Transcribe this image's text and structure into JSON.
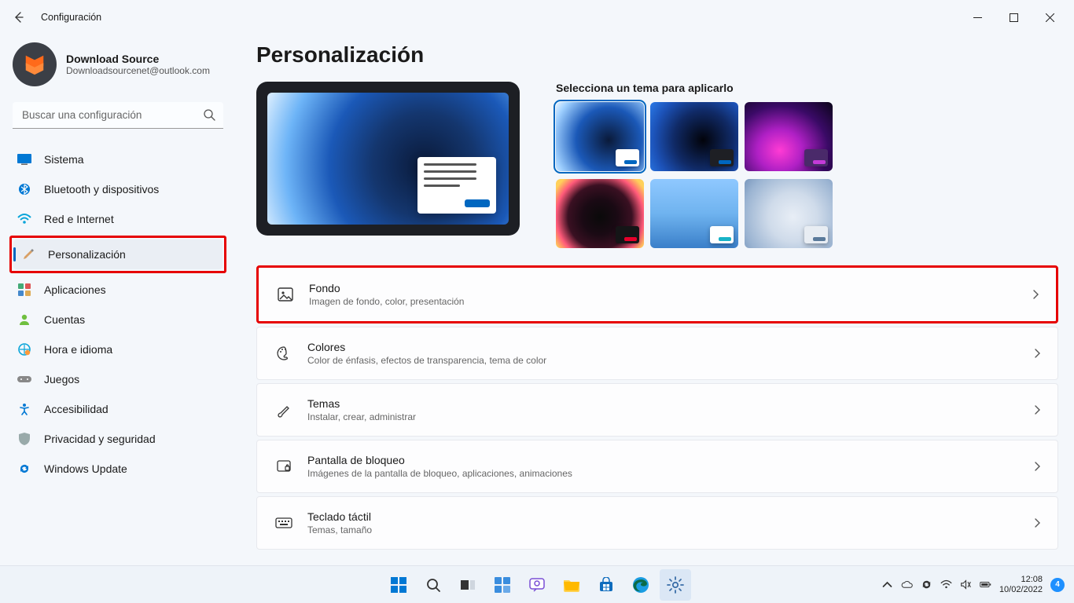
{
  "titlebar": {
    "title": "Configuración"
  },
  "profile": {
    "name": "Download Source",
    "email": "Downloadsourcenet@outlook.com"
  },
  "search": {
    "placeholder": "Buscar una configuración"
  },
  "sidebar": {
    "items": [
      {
        "label": "Sistema"
      },
      {
        "label": "Bluetooth y dispositivos"
      },
      {
        "label": "Red e Internet"
      },
      {
        "label": "Personalización"
      },
      {
        "label": "Aplicaciones"
      },
      {
        "label": "Cuentas"
      },
      {
        "label": "Hora e idioma"
      },
      {
        "label": "Juegos"
      },
      {
        "label": "Accesibilidad"
      },
      {
        "label": "Privacidad y seguridad"
      },
      {
        "label": "Windows Update"
      }
    ]
  },
  "content": {
    "heading": "Personalización",
    "themes_label": "Selecciona un tema para aplicarlo",
    "cards": [
      {
        "title": "Fondo",
        "subtitle": "Imagen de fondo, color, presentación"
      },
      {
        "title": "Colores",
        "subtitle": "Color de énfasis, efectos de transparencia, tema de color"
      },
      {
        "title": "Temas",
        "subtitle": "Instalar, crear, administrar"
      },
      {
        "title": "Pantalla de bloqueo",
        "subtitle": "Imágenes de la pantalla de bloqueo, aplicaciones, animaciones"
      },
      {
        "title": "Teclado táctil",
        "subtitle": "Temas, tamaño"
      }
    ]
  },
  "taskbar": {
    "time": "12:08",
    "date": "10/02/2022",
    "notification_count": "4"
  }
}
